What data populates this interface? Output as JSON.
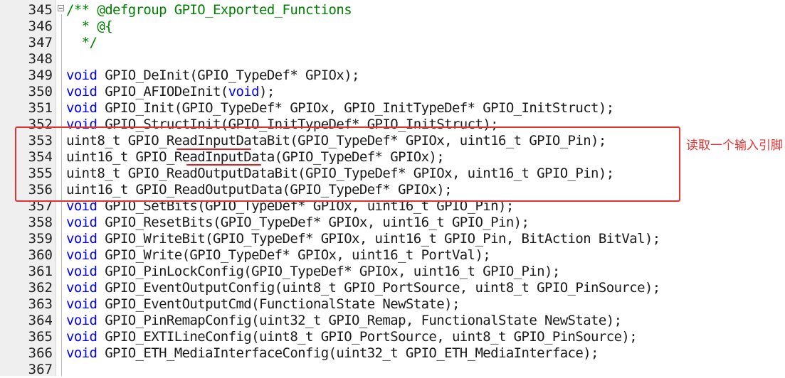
{
  "lines": [
    {
      "num": "345",
      "parts": [
        {
          "t": "/** @defgroup GPIO_Exported_Functions",
          "c": "cm"
        }
      ]
    },
    {
      "num": "346",
      "parts": [
        {
          "t": "  * @{",
          "c": "cm"
        }
      ]
    },
    {
      "num": "347",
      "parts": [
        {
          "t": "  */",
          "c": "cm"
        }
      ]
    },
    {
      "num": "348",
      "parts": []
    },
    {
      "num": "349",
      "parts": [
        {
          "t": "void",
          "c": "kw"
        },
        {
          "t": " GPIO_DeInit(GPIO_TypeDef* GPIOx);"
        }
      ]
    },
    {
      "num": "350",
      "parts": [
        {
          "t": "void",
          "c": "kw"
        },
        {
          "t": " GPIO_AFIODeInit("
        },
        {
          "t": "void",
          "c": "kw"
        },
        {
          "t": ");"
        }
      ]
    },
    {
      "num": "351",
      "parts": [
        {
          "t": "void",
          "c": "kw"
        },
        {
          "t": " GPIO_Init(GPIO_TypeDef* GPIOx, GPIO_InitTypeDef* GPIO_InitStruct);"
        }
      ]
    },
    {
      "num": "352",
      "parts": [
        {
          "t": "void",
          "c": "kw"
        },
        {
          "t": " GPIO_StructInit(GPIO_InitTypeDef* GPIO_InitStruct);"
        }
      ]
    },
    {
      "num": "353",
      "parts": [
        {
          "t": "uint8_t GPIO_ReadInputDataBit(GPIO_TypeDef* GPIOx, uint16_t GPIO_Pin);"
        }
      ]
    },
    {
      "num": "354",
      "parts": [
        {
          "t": "uint16_t GPIO_ReadInputData(GPIO_TypeDef* GPIOx);"
        }
      ]
    },
    {
      "num": "355",
      "parts": [
        {
          "t": "uint8_t GPIO_ReadOutputDataBit(GPIO_TypeDef* GPIOx, uint16_t GPIO_Pin);"
        }
      ]
    },
    {
      "num": "356",
      "parts": [
        {
          "t": "uint16_t GPIO_ReadOutputData(GPIO_TypeDef* GPIOx);"
        }
      ]
    },
    {
      "num": "357",
      "parts": [
        {
          "t": "void",
          "c": "kw"
        },
        {
          "t": " GPIO_SetBits(GPIO_TypeDef* GPIOx, uint16_t GPIO_Pin);"
        }
      ]
    },
    {
      "num": "358",
      "parts": [
        {
          "t": "void",
          "c": "kw"
        },
        {
          "t": " GPIO_ResetBits(GPIO_TypeDef* GPIOx, uint16_t GPIO_Pin);"
        }
      ]
    },
    {
      "num": "359",
      "parts": [
        {
          "t": "void",
          "c": "kw"
        },
        {
          "t": " GPIO_WriteBit(GPIO_TypeDef* GPIOx, uint16_t GPIO_Pin, BitAction BitVal);"
        }
      ]
    },
    {
      "num": "360",
      "parts": [
        {
          "t": "void",
          "c": "kw"
        },
        {
          "t": " GPIO_Write(GPIO_TypeDef* GPIOx, uint16_t PortVal);"
        }
      ]
    },
    {
      "num": "361",
      "parts": [
        {
          "t": "void",
          "c": "kw"
        },
        {
          "t": " GPIO_PinLockConfig(GPIO_TypeDef* GPIOx, uint16_t GPIO_Pin);"
        }
      ]
    },
    {
      "num": "362",
      "parts": [
        {
          "t": "void",
          "c": "kw"
        },
        {
          "t": " GPIO_EventOutputConfig(uint8_t GPIO_PortSource, uint8_t GPIO_PinSource);"
        }
      ]
    },
    {
      "num": "363",
      "parts": [
        {
          "t": "void",
          "c": "kw"
        },
        {
          "t": " GPIO_EventOutputCmd(FunctionalState NewState);"
        }
      ]
    },
    {
      "num": "364",
      "parts": [
        {
          "t": "void",
          "c": "kw"
        },
        {
          "t": " GPIO_PinRemapConfig(uint32_t GPIO_Remap, FunctionalState NewState);"
        }
      ]
    },
    {
      "num": "365",
      "parts": [
        {
          "t": "void",
          "c": "kw"
        },
        {
          "t": " GPIO_EXTILineConfig(uint8_t GPIO_PortSource, uint8_t GPIO_PinSource);"
        }
      ]
    },
    {
      "num": "366",
      "parts": [
        {
          "t": "void",
          "c": "kw"
        },
        {
          "t": " GPIO_ETH_MediaInterfaceConfig(uint32_t GPIO_ETH_MediaInterface);"
        }
      ]
    },
    {
      "num": "367",
      "parts": []
    }
  ],
  "annotation": {
    "text": "读取一个输入引脚",
    "color": "#e53333"
  },
  "colors": {
    "keyword": "#0000ff",
    "comment": "#008000",
    "highlight": "#e53333"
  }
}
